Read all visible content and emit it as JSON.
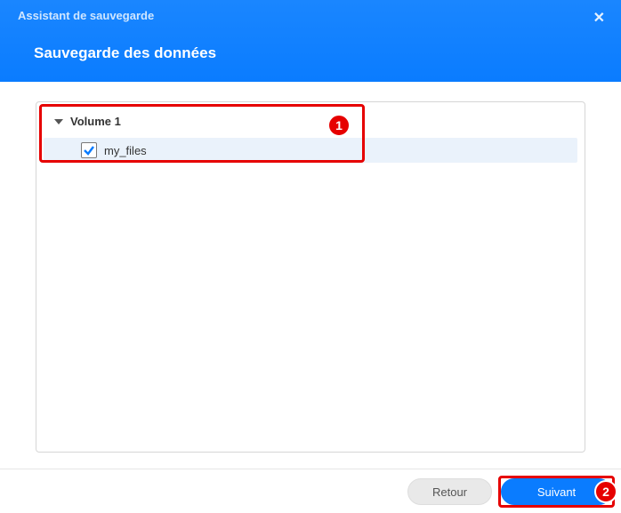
{
  "header": {
    "wizard_name": "Assistant de sauvegarde",
    "step_title": "Sauvegarde des données"
  },
  "tree": {
    "volume_label": "Volume 1",
    "items": [
      {
        "name": "my_files",
        "checked": true
      }
    ]
  },
  "callouts": {
    "one": "1",
    "two": "2"
  },
  "footer": {
    "back_label": "Retour",
    "next_label": "Suivant"
  }
}
